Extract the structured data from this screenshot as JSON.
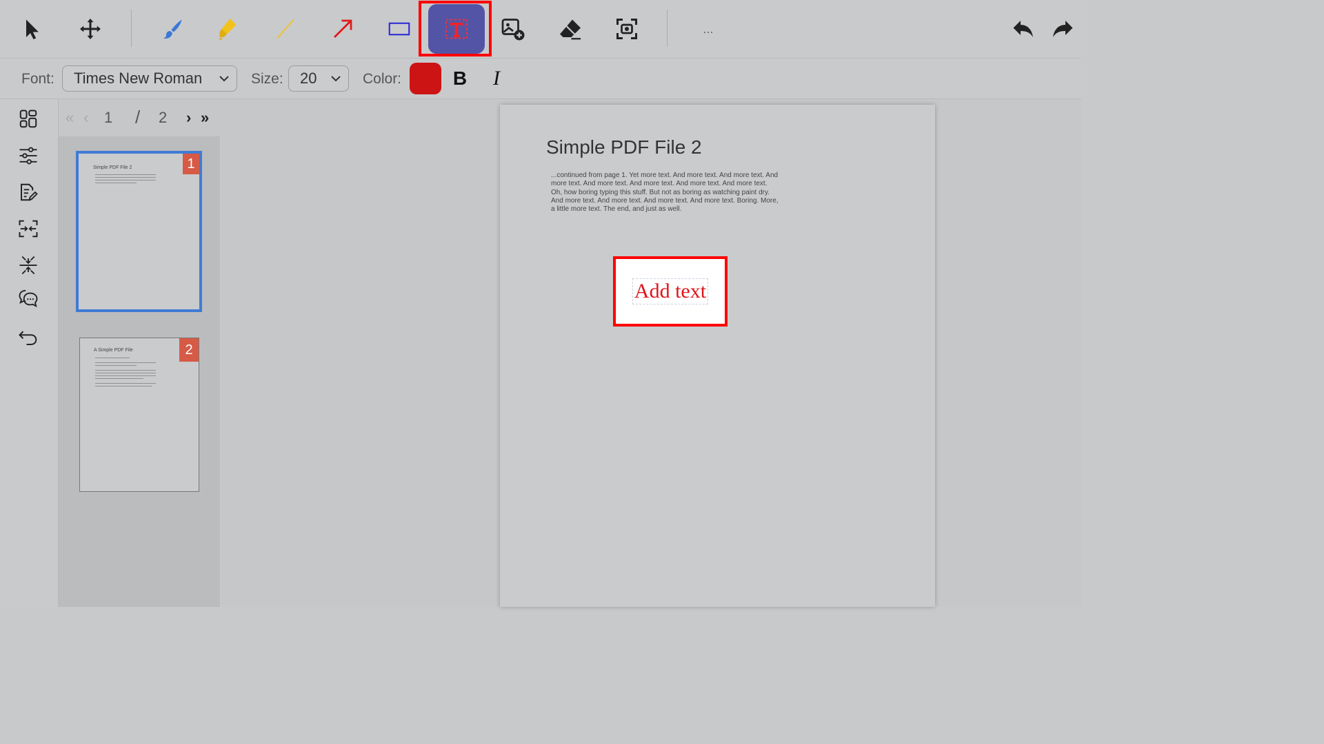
{
  "toolbar": {
    "tools": [
      {
        "name": "select-tool",
        "icon": "cursor-arrow-icon"
      },
      {
        "name": "move-tool",
        "icon": "move-arrows-icon"
      },
      {
        "name": "brush-tool",
        "icon": "paintbrush-icon"
      },
      {
        "name": "highlighter-tool",
        "icon": "highlighter-icon"
      },
      {
        "name": "line-tool",
        "icon": "line-icon"
      },
      {
        "name": "arrow-tool",
        "icon": "arrow-icon"
      },
      {
        "name": "rectangle-tool",
        "icon": "rectangle-icon"
      },
      {
        "name": "text-tool",
        "icon": "text-insert-icon",
        "active": true
      },
      {
        "name": "add-image-tool",
        "icon": "image-add-icon"
      },
      {
        "name": "eraser-tool",
        "icon": "eraser-icon"
      },
      {
        "name": "screenshot-tool",
        "icon": "screenshot-icon"
      }
    ],
    "more_label": "...",
    "undo_icon": "undo-icon",
    "redo_icon": "redo-icon",
    "colors": {
      "active_bg": "#5454a6",
      "highlight_frame": "#ff0000"
    }
  },
  "format_bar": {
    "font_label": "Font:",
    "font_value": "Times New Roman",
    "size_label": "Size:",
    "size_value": "20",
    "color_label": "Color:",
    "color_value": "#cc1414",
    "bold_label": "B",
    "italic_label": "I"
  },
  "left_rail": {
    "items": [
      {
        "name": "thumbnails",
        "icon": "grid-icon"
      },
      {
        "name": "adjust",
        "icon": "sliders-icon"
      },
      {
        "name": "edit-notes",
        "icon": "edit-document-icon"
      },
      {
        "name": "merge",
        "icon": "merge-icon"
      },
      {
        "name": "split",
        "icon": "split-icon"
      },
      {
        "name": "comments",
        "icon": "comments-icon"
      },
      {
        "name": "back",
        "icon": "return-icon"
      }
    ]
  },
  "pager": {
    "first": "«",
    "prev": "‹",
    "current": "1",
    "separator": "/",
    "total": "2",
    "next": "›",
    "last": "»"
  },
  "thumbnails": [
    {
      "number": "1",
      "title": "Simple PDF File 2",
      "selected": true
    },
    {
      "number": "2",
      "title": "A Simple PDF File",
      "selected": false
    }
  ],
  "document": {
    "title": "Simple PDF File 2",
    "body": "...continued from page 1. Yet more text. And more text. And more text. And more text. And more text. And more text. And more text. And more text. Oh, how boring typing this stuff. But not as boring as watching paint dry. And more text. And more text. And more text. And more text. Boring.  More, a little more text. The end, and just as well.",
    "text_box": "Add text"
  }
}
